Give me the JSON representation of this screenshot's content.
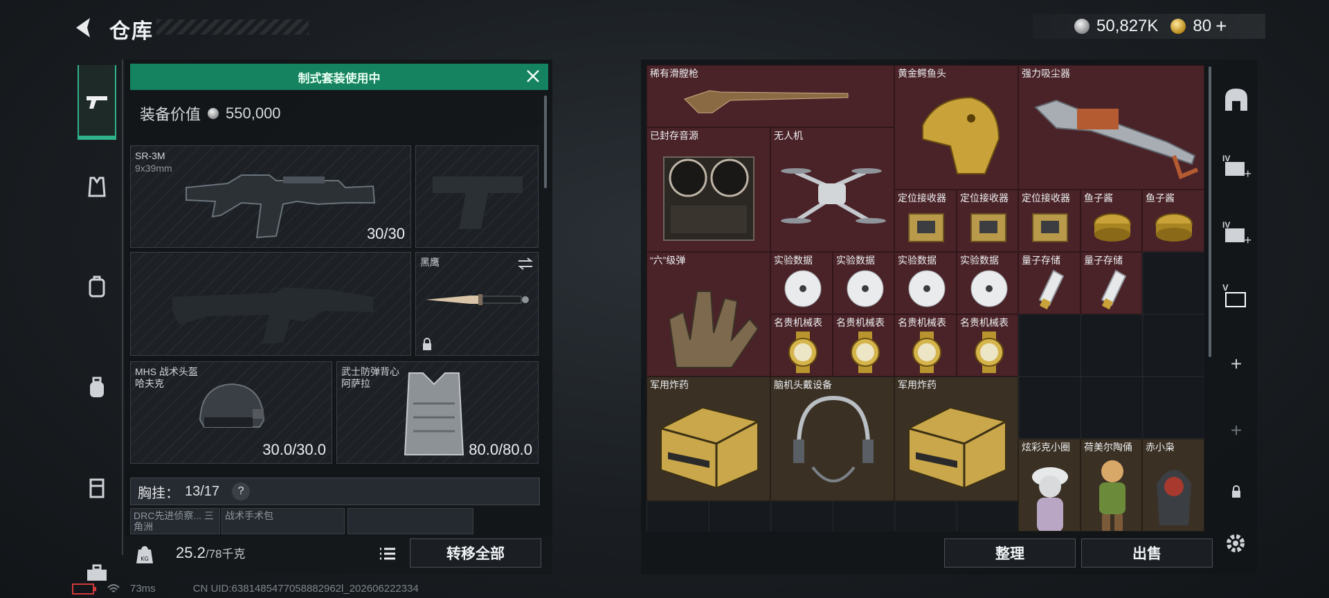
{
  "header": {
    "title": "仓库",
    "back_icon": "back-arrow-icon",
    "silver_amount": "50,827K",
    "gold_amount": "80",
    "add_gold": "+"
  },
  "left_rail": {
    "items": [
      {
        "name": "gun-icon",
        "active": true
      },
      {
        "name": "vest-icon"
      },
      {
        "name": "backpack-armor-icon"
      },
      {
        "name": "backpack-icon"
      },
      {
        "name": "case-icon"
      },
      {
        "name": "toolbox-icon"
      }
    ]
  },
  "loadout": {
    "banner": "制式套装使用中",
    "value_label": "装备价值",
    "value": "550,000",
    "primary": {
      "name": "SR-3M",
      "caliber": "9x39mm",
      "ammo": "30/30"
    },
    "knife": {
      "name": "黑鹰"
    },
    "helmet": {
      "name": "MHS 战术头盔",
      "sub": "哈夫克",
      "durability": "30.0/30.0"
    },
    "armor": {
      "name": "武士防弹背心",
      "sub": "阿萨拉",
      "durability": "80.0/80.0"
    },
    "chest_rig_label": "胸挂：",
    "chest_rig_value": "13/17",
    "chest_help": "?",
    "mini_slots": [
      "DRC先进侦察... 三角洲",
      "战术手术包"
    ],
    "weight": "25.2",
    "weight_max": "/78千克",
    "transfer_all": "转移全部"
  },
  "storage": {
    "items": [
      {
        "label": "稀有滑膛枪",
        "icon": "musket-icon",
        "tone": "red"
      },
      {
        "label": "黄金鳄鱼头",
        "icon": "golden-croc-head-icon",
        "tone": "red"
      },
      {
        "label": "强力吸尘器",
        "icon": "vacuum-icon",
        "tone": "red"
      },
      {
        "label": "已封存音源",
        "icon": "reel-recorder-icon",
        "tone": "red"
      },
      {
        "label": "无人机",
        "icon": "drone-icon",
        "tone": "red"
      },
      {
        "label": "定位接收器",
        "icon": "receiver-icon",
        "tone": "red"
      },
      {
        "label": "定位接收器",
        "icon": "receiver-icon",
        "tone": "red"
      },
      {
        "label": "定位接收器",
        "icon": "receiver-icon",
        "tone": "red"
      },
      {
        "label": "鱼子酱",
        "icon": "caviar-icon",
        "tone": "red"
      },
      {
        "label": "鱼子酱",
        "icon": "caviar-icon",
        "tone": "red"
      },
      {
        "label": "“六”级弹",
        "icon": "ammo-hand-icon",
        "tone": "red"
      },
      {
        "label": "实验数据",
        "icon": "disc-icon",
        "tone": "red"
      },
      {
        "label": "实验数据",
        "icon": "disc-icon",
        "tone": "red"
      },
      {
        "label": "实验数据",
        "icon": "disc-icon",
        "tone": "red"
      },
      {
        "label": "实验数据",
        "icon": "disc-icon",
        "tone": "red"
      },
      {
        "label": "量子存储",
        "icon": "usb-icon",
        "tone": "red"
      },
      {
        "label": "量子存储",
        "icon": "usb-icon",
        "tone": "red"
      },
      {
        "label": "名贵机械表",
        "icon": "watch-icon",
        "tone": "red"
      },
      {
        "label": "名贵机械表",
        "icon": "watch-icon",
        "tone": "red"
      },
      {
        "label": "名贵机械表",
        "icon": "watch-icon",
        "tone": "red"
      },
      {
        "label": "名贵机械表",
        "icon": "watch-icon",
        "tone": "red"
      },
      {
        "label": "军用炸药",
        "icon": "explosive-crate-icon",
        "tone": "gold"
      },
      {
        "label": "脑机头戴设备",
        "icon": "headset-icon",
        "tone": "gold"
      },
      {
        "label": "军用炸药",
        "icon": "explosive-crate-icon",
        "tone": "gold"
      },
      {
        "label": "炫彩克小圈",
        "icon": "figurine-icon",
        "tone": "gold"
      },
      {
        "label": "荷美尔陶俑",
        "icon": "figurine-icon",
        "tone": "gold"
      },
      {
        "label": "赤小枭",
        "icon": "figurine-icon",
        "tone": "gold"
      }
    ],
    "sort_label": "整理",
    "sell_label": "出售"
  },
  "right_rail": {
    "items": [
      "safe-icon",
      "iv-container-add-icon",
      "iv-container-add-icon",
      "v-container-icon",
      "add-icon",
      "add-icon",
      "lock-icon"
    ],
    "labels": {
      "iv1": "IV",
      "iv2": "IV",
      "v": "V",
      "add": "+"
    }
  },
  "status": {
    "ping": "73ms",
    "uid": "CN UID:6381485477058882962l_202606222334"
  },
  "colors": {
    "accent_green": "#15835f",
    "rare_red": "#4a2328",
    "legend_gold": "#3b3024"
  }
}
